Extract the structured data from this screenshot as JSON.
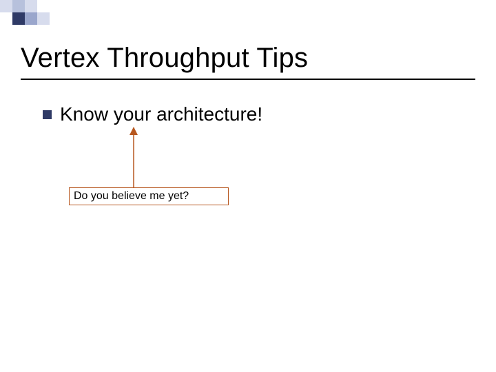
{
  "slide": {
    "title": "Vertex Throughput Tips",
    "bullets": [
      {
        "label": "Know your architecture!"
      }
    ],
    "callout": {
      "text": "Do you believe me yet?"
    }
  },
  "colors": {
    "accent": "#2f3a66",
    "accent_light": "#9aa6cc",
    "arrow": "#b7571f"
  }
}
